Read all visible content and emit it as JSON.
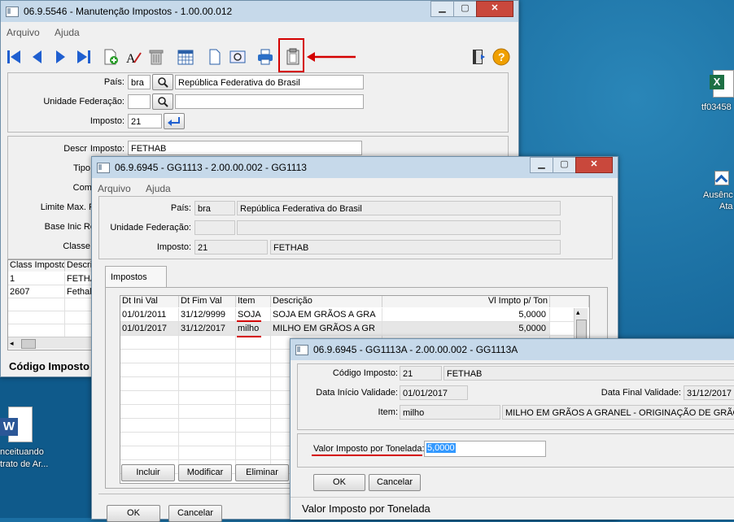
{
  "desktop": {
    "icon_right_label": "tf03458",
    "icon_right2_label_1": "Ausênc",
    "icon_right2_label_2": "Ata",
    "icon_left_label_1": "nceituando",
    "icon_left_label_2": "trato de Ar..."
  },
  "main_window": {
    "title": "06.9.5546 - Manutenção Impostos - 1.00.00.012",
    "menu": [
      "Arquivo",
      "Ajuda"
    ],
    "pais_label": "País:",
    "pais_code": "bra",
    "pais_name": "República Federativa do Brasil",
    "uf_label": "Unidade Federação:",
    "imposto_label": "Imposto:",
    "imposto_value": "21",
    "descr_label": "Descr",
    "descr_label2": "Imposto:",
    "descr_value": "FETHAB",
    "tipo_label": "Tipo",
    "comp_label": "Comp",
    "limite_label": "Limite Max. R",
    "base_label": "Base Inic Re",
    "classe_label": "Classe",
    "grid_headers": [
      "Class Imposto",
      "Descriç"
    ],
    "grid_rows": [
      [
        "1",
        "FETHA"
      ],
      [
        "2607",
        "Fethal"
      ]
    ],
    "bottom_label": "Código Imposto"
  },
  "gg1113": {
    "title": "06.9.6945 - GG1113 - 2.00.00.002 - GG1113",
    "menu": [
      "Arquivo",
      "Ajuda"
    ],
    "pais_label": "País:",
    "pais_code": "bra",
    "pais_name": "República Federativa do Brasil",
    "uf_label": "Unidade Federação:",
    "imposto_label": "Imposto:",
    "imposto_value": "21",
    "imposto_name": "FETHAB",
    "tab": "Impostos",
    "grid_headers": [
      "Dt Ini Val",
      "Dt Fim Val",
      "Item",
      "Descrição",
      "Vl Impto p/ Ton"
    ],
    "grid_rows": [
      [
        "01/01/2011",
        "31/12/9999",
        "SOJA",
        "SOJA EM GRÃOS A GRA",
        "5,0000"
      ],
      [
        "01/01/2017",
        "31/12/2017",
        "milho",
        "MILHO EM GRÃOS A GR",
        "5,0000"
      ]
    ],
    "btn_incluir": "Incluir",
    "btn_modificar": "Modificar",
    "btn_eliminar": "Eliminar",
    "btn_ok": "OK",
    "btn_cancelar": "Cancelar"
  },
  "gg1113a": {
    "title": "06.9.6945 - GG1113A - 2.00.00.002 - GG1113A",
    "codigo_label": "Código Imposto:",
    "codigo_value": "21",
    "codigo_name": "FETHAB",
    "data_inicio_label": "Data Início Validade:",
    "data_inicio_value": "01/01/2017",
    "data_final_label": "Data Final Validade:",
    "data_final_value": "31/12/2017",
    "item_label": "Item:",
    "item_value": "milho",
    "item_desc": "MILHO EM GRÃOS A GRANEL - ORIGINAÇÃO DE GRÃOS",
    "valor_label": "Valor Imposto por Tonelada:",
    "valor_value": "5,0000",
    "btn_ok": "OK",
    "btn_cancelar": "Cancelar",
    "status_text": "Valor Imposto por Tonelada"
  },
  "colors": {
    "annotation_red": "#d40000",
    "titlebar": "#c6d9ea",
    "desktop": "#1b6fa3"
  }
}
